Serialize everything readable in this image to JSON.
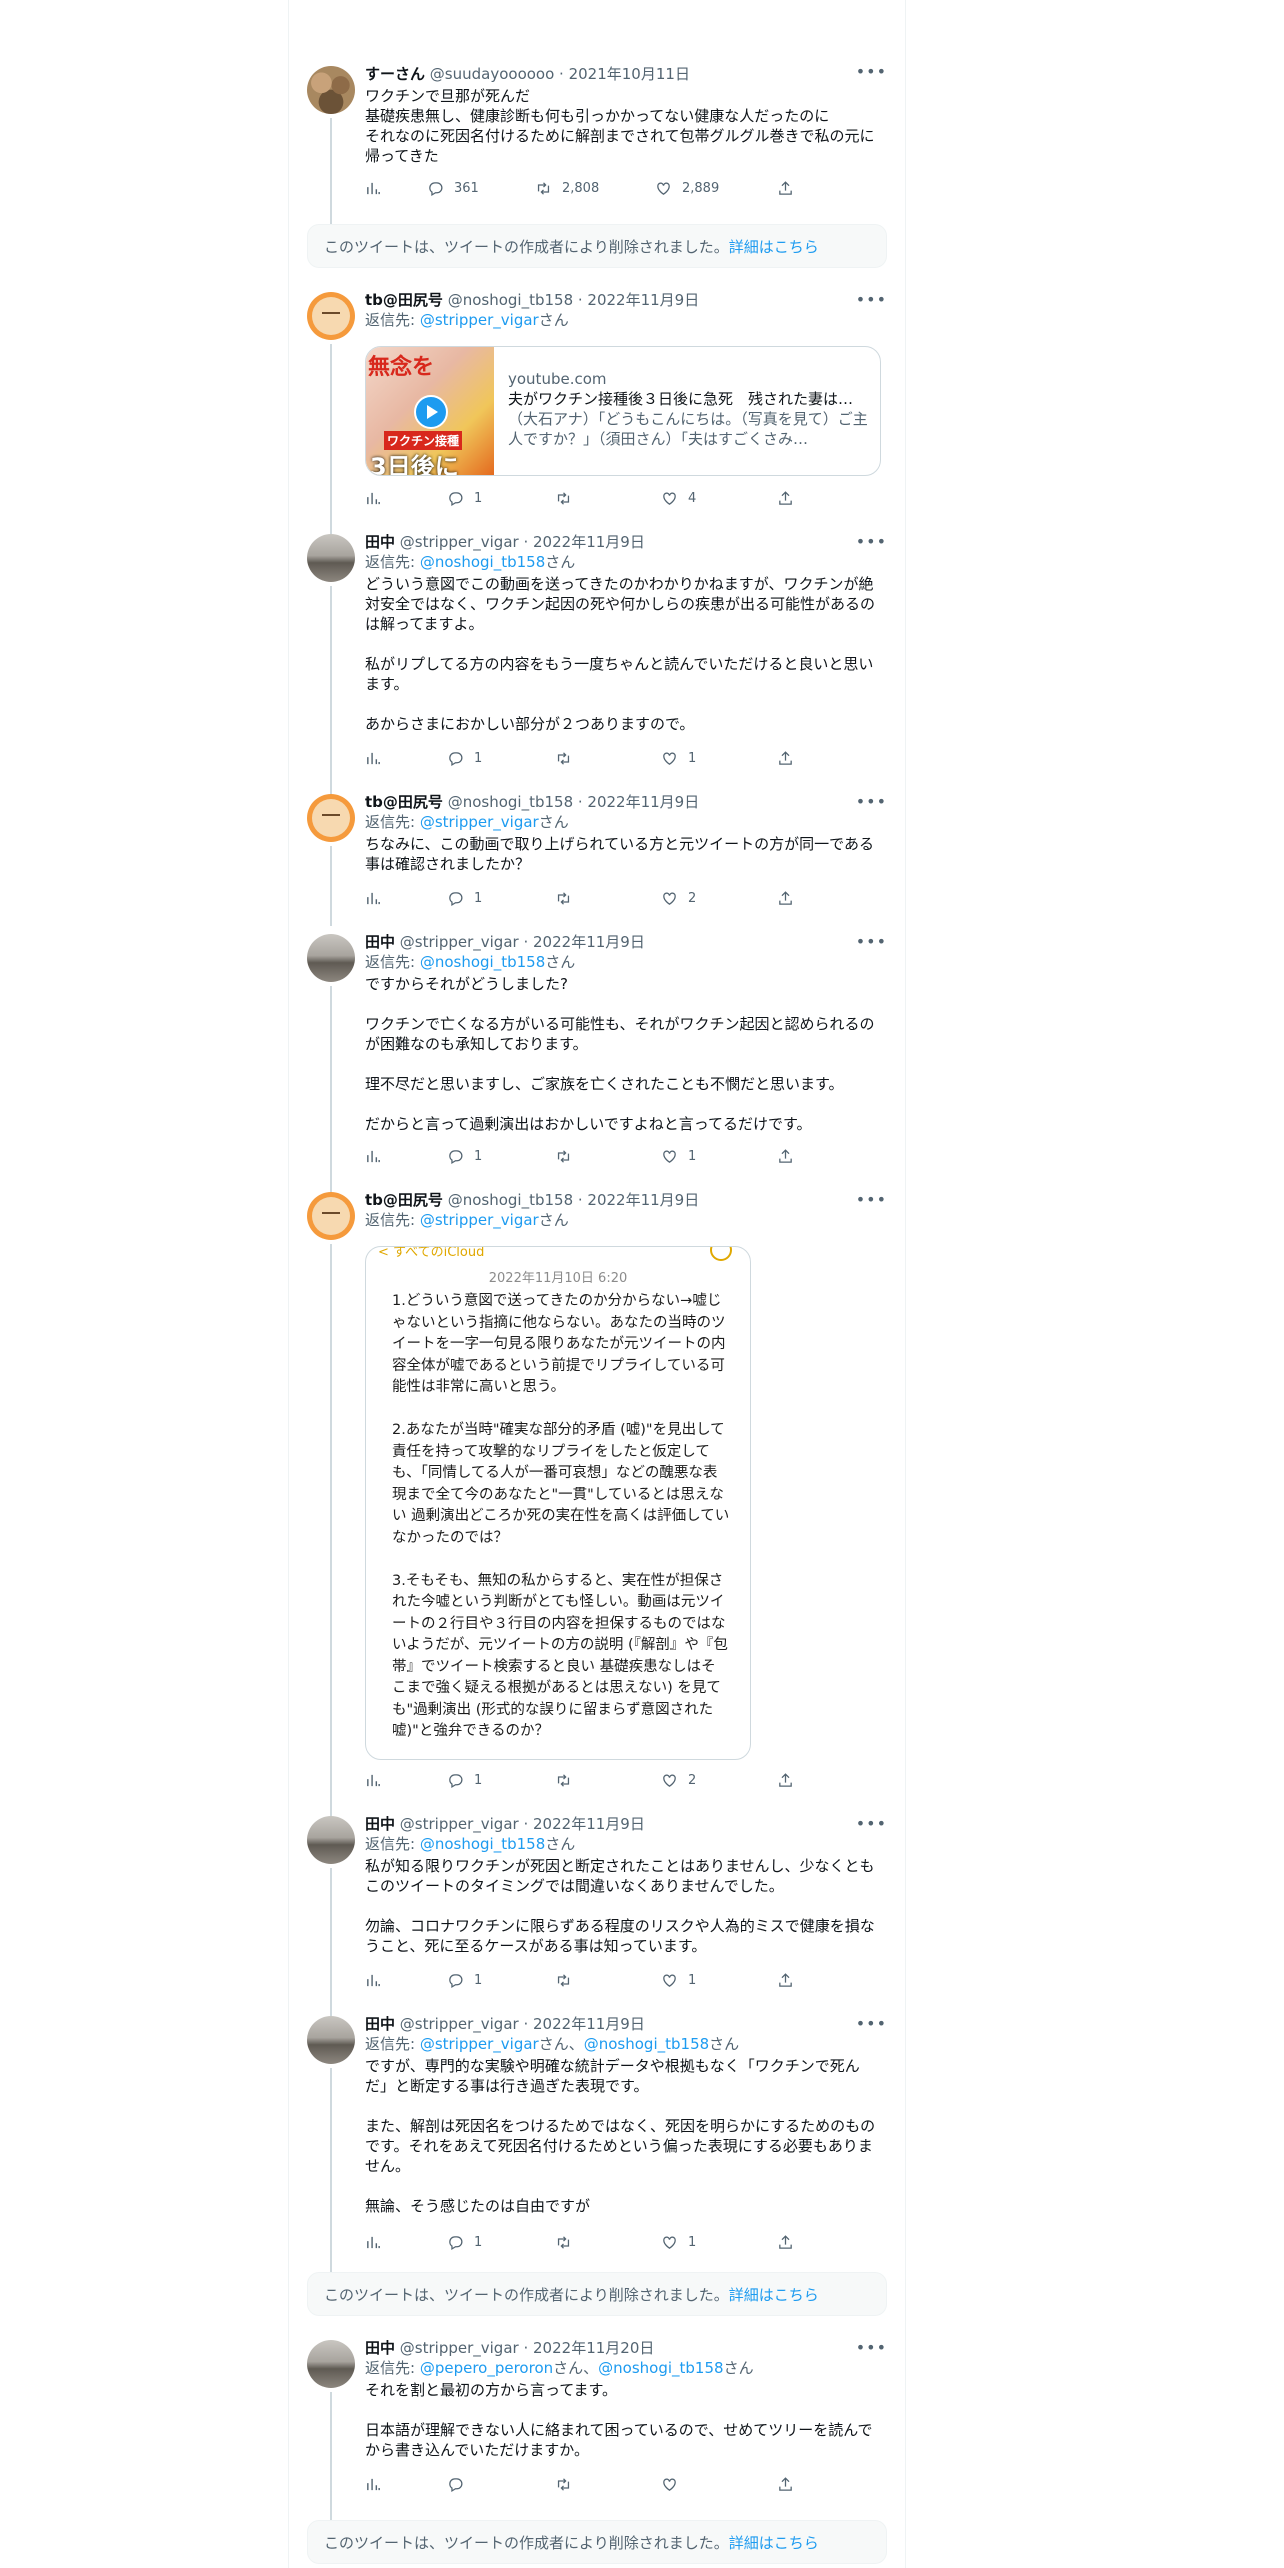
{
  "tweets": [
    {
      "name": "すーさん",
      "handle": "@suudayoooooo",
      "date": "2021年10月11日",
      "text": "ワクチンで旦那が死んだ\n基礎疾患無し、健康診断も何も引っかかってない健康な人だったのに\nそれなのに死因名付けるために解剖までされて包帯グルグル巻きで私の元に帰ってきた",
      "replies": "361",
      "retweets": "2,808",
      "likes": "2,889"
    },
    {
      "name": "tb@田尻号",
      "handle": "@noshogi_tb158",
      "date": "2022年11月9日",
      "reply_prefix": "返信先: ",
      "reply_to": "@stripper_vigar",
      "reply_suffix": "さん",
      "card": {
        "thumb_text1": "無念を",
        "thumb_text2": "ワクチン接種",
        "thumb_text3": "3日後に",
        "domain": "youtube.com",
        "title": "夫がワクチン接種後３日後に急死　残された妻は…",
        "desc": "（大石アナ）「どうもこんにちは。（写真を見て）ご主人ですか？」（須田さん）「夫はすごくさみ…"
      },
      "replies": "1",
      "retweets": "",
      "likes": "4"
    },
    {
      "name": "田中",
      "handle": "@stripper_vigar",
      "date": "2022年11月9日",
      "reply_prefix": "返信先: ",
      "reply_to": "@noshogi_tb158",
      "reply_suffix": "さん",
      "text": "どういう意図でこの動画を送ってきたのかわかりかねますが、ワクチンが絶対安全ではなく、ワクチン起因の死や何かしらの疾患が出る可能性があるのは解ってますよ。\n\n私がリプしてる方の内容をもう一度ちゃんと読んでいただけると良いと思います。\n\nあからさまにおかしい部分が２つありますので。",
      "replies": "1",
      "retweets": "",
      "likes": "1"
    },
    {
      "name": "tb@田尻号",
      "handle": "@noshogi_tb158",
      "date": "2022年11月9日",
      "reply_prefix": "返信先: ",
      "reply_to": "@stripper_vigar",
      "reply_suffix": "さん",
      "text": "ちなみに、この動画で取り上げられている方と元ツイートの方が同一である事は確認されましたか？",
      "replies": "1",
      "retweets": "",
      "likes": "2"
    },
    {
      "name": "田中",
      "handle": "@stripper_vigar",
      "date": "2022年11月9日",
      "reply_prefix": "返信先: ",
      "reply_to": "@noshogi_tb158",
      "reply_suffix": "さん",
      "text": "ですからそれがどうしました?\n\nワクチンで亡くなる方がいる可能性も、それがワクチン起因と認められるのが困難なのも承知しております。\n\n理不尽だと思いますし、ご家族を亡くされたことも不憫だと思います。\n\nだからと言って過剰演出はおかしいですよねと言ってるだけです。",
      "replies": "1",
      "retweets": "",
      "likes": "1"
    },
    {
      "name": "tb@田尻号",
      "handle": "@noshogi_tb158",
      "date": "2022年11月9日",
      "reply_prefix": "返信先: ",
      "reply_to": "@stripper_vigar",
      "reply_suffix": "さん",
      "memo": {
        "top": "< すべてのiCloud",
        "date": "2022年11月10日 6:20",
        "text": "1.どういう意図で送ってきたのか分からない→嘘じゃないという指摘に他ならない。あなたの当時のツイートを一字一句見る限りあなたが元ツイートの内容全体が嘘であるという前提でリプライしている可能性は非常に高いと思う。\n\n2.あなたが当時\"確実な部分的矛盾 (嘘)\"を見出して責任を持って攻撃的なリプライをしたと仮定しても、「同情してる人が一番可哀想」などの醜悪な表現まで全て今のあなたと\"一貫\"しているとは思えない 過剰演出どころか死の実在性を高くは評価していなかったのでは？\n\n3.そもそも、無知の私からすると、実在性が担保された今嘘という判断がとても怪しい。動画は元ツイートの２行目や３行目の内容を担保するものではないようだが、元ツイートの方の説明 (『解剖』や『包帯』でツイート検索すると良い 基礎疾患なしはそこまで強く疑える根拠があるとは思えない) を見ても\"過剰演出 (形式的な誤りに留まらず意図された嘘)\"と強弁できるのか？"
      },
      "replies": "1",
      "retweets": "",
      "likes": "2"
    },
    {
      "name": "田中",
      "handle": "@stripper_vigar",
      "date": "2022年11月9日",
      "reply_prefix": "返信先: ",
      "reply_to": "@noshogi_tb158",
      "reply_suffix": "さん",
      "text": "私が知る限りワクチンが死因と断定されたことはありませんし、少なくともこのツイートのタイミングでは間違いなくありませんでした。\n\n勿論、コロナワクチンに限らずある程度のリスクや人為的ミスで健康を損なうこと、死に至るケースがある事は知っています。",
      "replies": "1",
      "retweets": "",
      "likes": "1"
    },
    {
      "name": "田中",
      "handle": "@stripper_vigar",
      "date": "2022年11月9日",
      "reply_prefix": "返信先: ",
      "reply_to": "@stripper_vigar",
      "reply_mid": "さん、",
      "reply_to2": "@noshogi_tb158",
      "reply_suffix": "さん",
      "text": "ですが、専門的な実験や明確な統計データや根拠もなく「ワクチンで死んだ」と断定する事は行き過ぎた表現です。\n\nまた、解剖は死因名をつけるためではなく、死因を明らかにするためのものです。それをあえて死因名付けるためという偏った表現にする必要もありません。\n\n無論、そう感じたのは自由ですが",
      "replies": "1",
      "retweets": "",
      "likes": "1"
    },
    {
      "name": "田中",
      "handle": "@stripper_vigar",
      "date": "2022年11月20日",
      "reply_prefix": "返信先: ",
      "reply_to": "@pepero_peroron",
      "reply_mid": "さん、",
      "reply_to2": "@noshogi_tb158",
      "reply_suffix": "さん",
      "text": "それを割と最初の方から言ってます。\n\n日本語が理解できない人に絡まれて困っているので、せめてツリーを読んでから書き込んでいただけますか。",
      "replies": "",
      "retweets": "",
      "likes": ""
    }
  ],
  "deleted_notice": {
    "text": "このツイートは、ツイートの作成者により削除されました。",
    "link": "詳細はこちら"
  },
  "separator": " · "
}
